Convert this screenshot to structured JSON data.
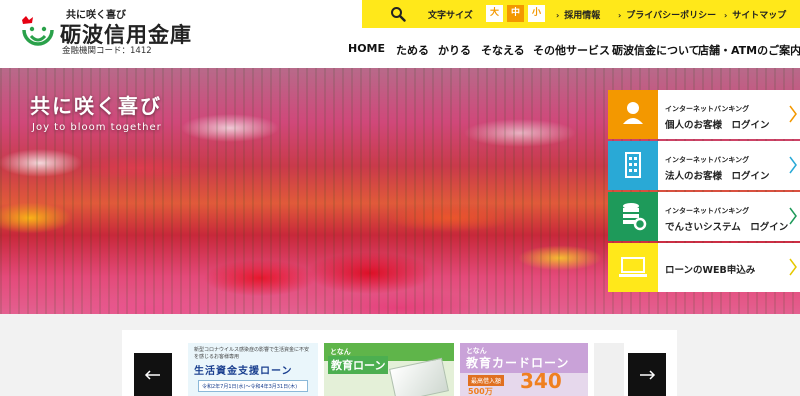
{
  "brand": {
    "tagline": "共に咲く喜び",
    "name": "砺波信用金庫",
    "code": "金融機関コード：1412",
    "colors": {
      "accent_yellow": "#ffe81a",
      "accent_orange": "#f39800",
      "logo_green": "#2aa14a",
      "logo_red": "#e60012"
    }
  },
  "utility": {
    "search_icon": "search-icon",
    "font_size_label": "文字サイズ",
    "sizes": [
      "大",
      "中",
      "小"
    ],
    "links": [
      "採用情報",
      "プライバシーポリシー",
      "サイトマップ"
    ]
  },
  "nav": {
    "items": [
      "HOME",
      "ためる",
      "かりる",
      "そなえる",
      "その他サービス",
      "砺波信金について",
      "店舗・ATMのご案内"
    ]
  },
  "hero": {
    "title": "共に咲く喜び",
    "subtitle": "Joy to bloom together"
  },
  "logins": [
    {
      "small": "インターネットバンキング",
      "big": "個人のお客様　ログイン",
      "icon": "person-icon",
      "color": "#f39800"
    },
    {
      "small": "インターネットバンキング",
      "big": "法人のお客様　ログイン",
      "icon": "building-icon",
      "color": "#29a9d6"
    },
    {
      "small": "インターネットバンキング",
      "big": "でんさいシステム　ログイン",
      "icon": "database-gear-icon",
      "color": "#1e9a5a"
    },
    {
      "small": "",
      "big": "ローンのWEB申込み",
      "icon": "laptop-icon",
      "color": "#ffe81a"
    }
  ],
  "banners": {
    "b1": {
      "top": "新型コロナウイルス感染症の影響で生活資金に不安を感じるお客様専用",
      "main": "生活資金支援ローン",
      "date": "令和2年7月1日(水)〜令和4年3月31日(木)"
    },
    "b2": {
      "brand": "となん",
      "main": "教育ローン"
    },
    "b3": {
      "brand": "となん",
      "main": "教育カードローン",
      "note": "最高借入額",
      "num": "340",
      "small": "500万"
    }
  },
  "carousel": {
    "prev_icon": "arrow-left-icon",
    "next_icon": "arrow-right-icon"
  }
}
